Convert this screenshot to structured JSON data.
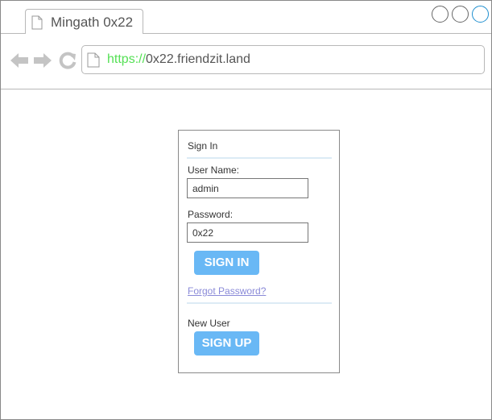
{
  "tab": {
    "title": "Mingath 0x22"
  },
  "address": {
    "scheme": "https://",
    "host": "0x22.friendzit.land"
  },
  "signin": {
    "title": "Sign In",
    "username_label": "User Name:",
    "username_value": "admin",
    "password_label": "Password:",
    "password_value": "0x22",
    "signin_button": "SIGN IN",
    "forgot_link": "Forgot Password?",
    "new_user_label": "New User",
    "signup_button": "SIGN UP"
  },
  "icons": {
    "tab": "document-icon",
    "back": "back-arrow-icon",
    "forward": "forward-arrow-icon",
    "reload": "reload-icon",
    "address": "document-icon"
  },
  "colors": {
    "button": "#69b8f5",
    "scheme": "#55e055",
    "link": "#8a8ad8",
    "divider": "#dcebf5"
  }
}
